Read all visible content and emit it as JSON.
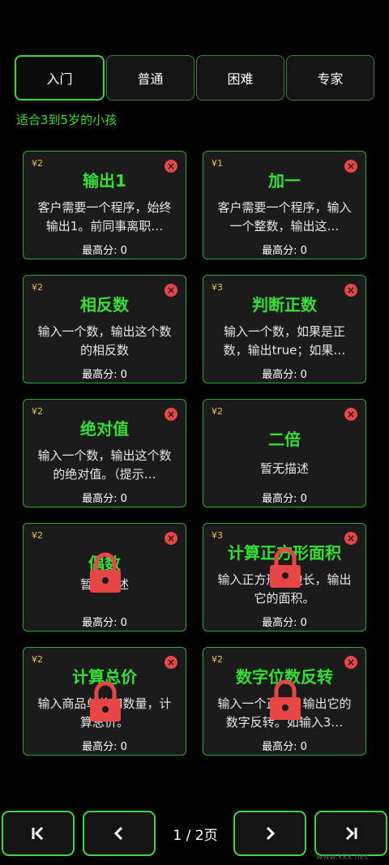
{
  "tabs": [
    {
      "label": "入门",
      "active": true
    },
    {
      "label": "普通",
      "active": false
    },
    {
      "label": "困难",
      "active": false
    },
    {
      "label": "专家",
      "active": false
    }
  ],
  "subtitle": "适合3到5岁的小孩",
  "cards": [
    {
      "cost": "¥2",
      "title": "输出1",
      "desc": "客户需要一个程序，始终输出1。前同事离职…",
      "score": "最高分: 0",
      "locked": false
    },
    {
      "cost": "¥1",
      "title": "加一",
      "desc": "客户需要一个程序，输入一个整数，输出这…",
      "score": "最高分: 0",
      "locked": false
    },
    {
      "cost": "¥2",
      "title": "相反数",
      "desc": "输入一个数，输出这个数的相反数",
      "score": "最高分: 0",
      "locked": false
    },
    {
      "cost": "¥3",
      "title": "判断正数",
      "desc": "输入一个数，如果是正数，输出true；如果…",
      "score": "最高分: 0",
      "locked": false
    },
    {
      "cost": "¥2",
      "title": "绝对值",
      "desc": "输入一个数，输出这个数的绝对值。（提示…",
      "score": "最高分: 0",
      "locked": false
    },
    {
      "cost": "¥2",
      "title": "二倍",
      "desc": "暂无描述",
      "score": "最高分: 0",
      "locked": false
    },
    {
      "cost": "¥2",
      "title": "偶数",
      "desc": "暂无描述",
      "score": "最高分: 0",
      "locked": true
    },
    {
      "cost": "¥3",
      "title": "计算正方形面积",
      "desc": "输入正方形的边长，输出它的面积。",
      "score": "最高分: 0",
      "locked": true
    },
    {
      "cost": "¥2",
      "title": "计算总价",
      "desc": "输入商品单价和数量，计算总价。",
      "score": "最高分: 0",
      "locked": true
    },
    {
      "cost": "¥2",
      "title": "数字位数反转",
      "desc": "输入一个正数，输出它的数字反转。如输入3…",
      "score": "最高分: 0",
      "locked": true
    }
  ],
  "pager": {
    "info": "1 / 2页"
  },
  "watermark": "www.kkx.net",
  "colors": {
    "accent": "#3dd63d",
    "title": "#33e033",
    "close": "#e84545",
    "lock": "#e84545",
    "cost": "#e8c14a"
  }
}
